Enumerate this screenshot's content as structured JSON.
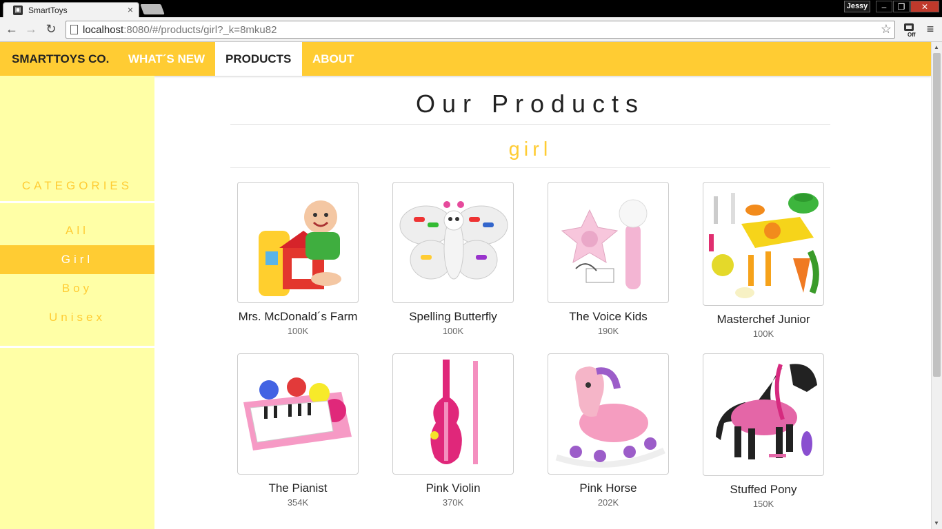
{
  "browser": {
    "tab_title": "SmartToys",
    "tab_close": "×",
    "user_badge": "Jessy",
    "url_host": "localhost",
    "url_path": ":8080/#/products/girl?_k=8mku82",
    "star": "☆",
    "window_buttons": [
      "–",
      "❐",
      "✕"
    ],
    "back": "←",
    "forward": "→",
    "reload": "↻",
    "menu": "≡",
    "ext_label": "Off"
  },
  "navbar": {
    "brand": "SMARTTOYS CO.",
    "items": [
      {
        "label": "WHAT´S NEW",
        "active": false
      },
      {
        "label": "PRODUCTS",
        "active": true
      },
      {
        "label": "ABOUT",
        "active": false
      }
    ],
    "color": "#ffcc33"
  },
  "sidebar": {
    "title": "CATEGORIES",
    "items": [
      {
        "label": "All",
        "active": false
      },
      {
        "label": "Girl",
        "active": true
      },
      {
        "label": "Boy",
        "active": false
      },
      {
        "label": "Unisex",
        "active": false
      }
    ],
    "background": "#ffffa6"
  },
  "main": {
    "heading": "Our Products",
    "subheading": "girl",
    "products": [
      {
        "name": "Mrs. McDonald´s Farm",
        "count": "100K",
        "icon": "farm-toy-icon"
      },
      {
        "name": "Spelling Butterfly",
        "count": "100K",
        "icon": "butterfly-toy-icon"
      },
      {
        "name": "The Voice Kids",
        "count": "190K",
        "icon": "microphone-toy-icon"
      },
      {
        "name": "Masterchef Junior",
        "count": "100K",
        "icon": "kitchen-set-icon"
      },
      {
        "name": "The Pianist",
        "count": "354K",
        "icon": "piano-toy-icon"
      },
      {
        "name": "Pink Violin",
        "count": "370K",
        "icon": "violin-toy-icon"
      },
      {
        "name": "Pink Horse",
        "count": "202K",
        "icon": "rocking-horse-icon"
      },
      {
        "name": "Stuffed Pony",
        "count": "150K",
        "icon": "pony-toy-icon"
      }
    ]
  }
}
